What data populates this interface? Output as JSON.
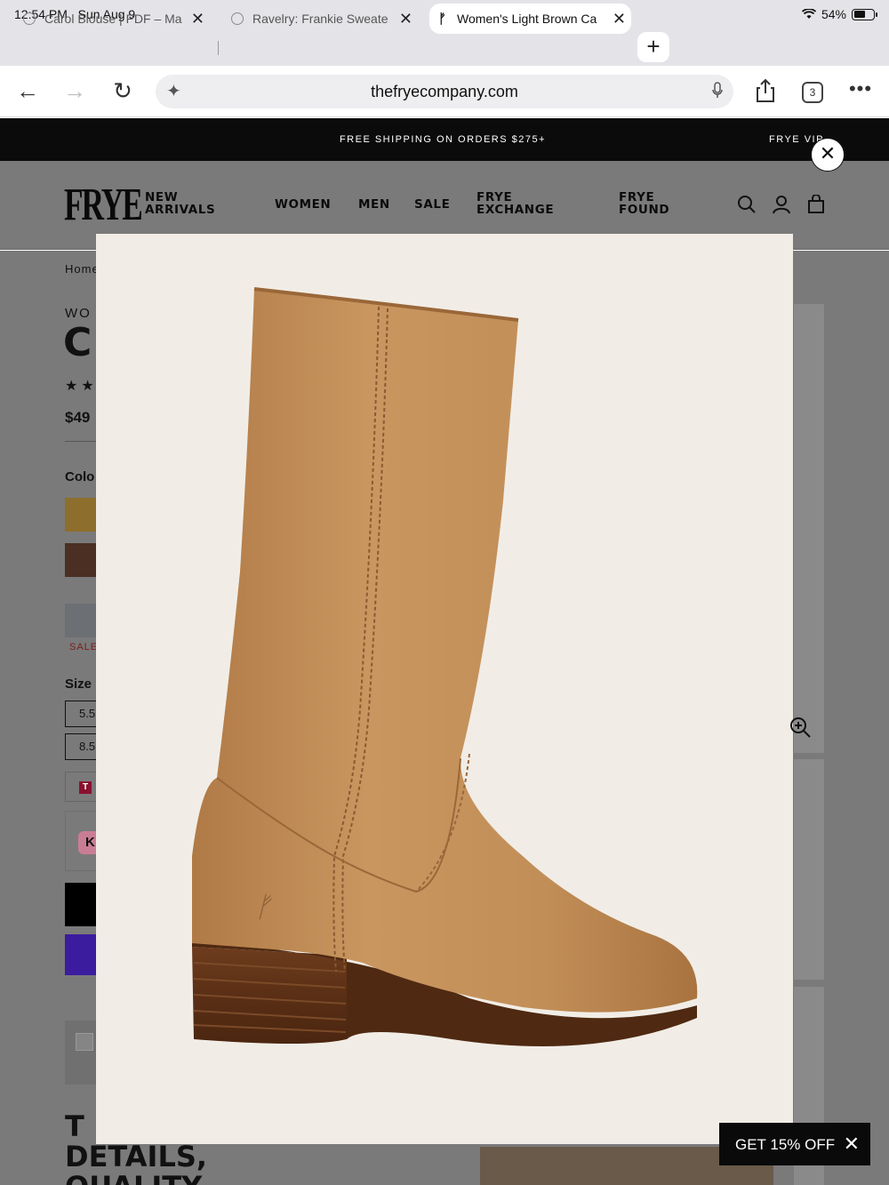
{
  "status_bar": {
    "time": "12:54 PM",
    "date": "Sun Aug 9",
    "battery": "54%"
  },
  "tabs": [
    {
      "title": "Carol Blouse | PDF – Ma",
      "active": false
    },
    {
      "title": "Ravelry: Frankie Sweate",
      "active": false
    },
    {
      "title": "Women's Light Brown Ca",
      "active": true
    }
  ],
  "toolbar": {
    "url": "thefryecompany.com",
    "tab_count": "3"
  },
  "promo": {
    "message": "FREE SHIPPING ON ORDERS $275+",
    "message2": "FRYE VIP"
  },
  "site_nav": {
    "logo": "FRYE",
    "new_arrivals": [
      "NEW",
      "ARRIVALS"
    ],
    "women": "WOMEN",
    "men": "MEN",
    "sale": "SALE",
    "frye_exchange": [
      "FRYE",
      "EXCHANGE"
    ],
    "frye_found": [
      "FRYE",
      "FOUND"
    ]
  },
  "product": {
    "breadcrumb": "Home",
    "category": "WO",
    "name_fragment": "C",
    "price": "$49",
    "color_label": "Colo",
    "sale_label": "SALE",
    "size_label": "Size",
    "sizes": [
      "5.5",
      "8.5"
    ],
    "badge_t": "T",
    "badge_k": "K"
  },
  "footer_headline": [
    "T",
    "DETAILS,",
    "QUALITY"
  ],
  "offer": {
    "label": "GET 15% OFF"
  },
  "colors": {
    "promo_bg": "#0b0b0b",
    "overlay": "#7a7a7a",
    "modal_bg": "#f1ede6",
    "leather": "#c6915c"
  }
}
